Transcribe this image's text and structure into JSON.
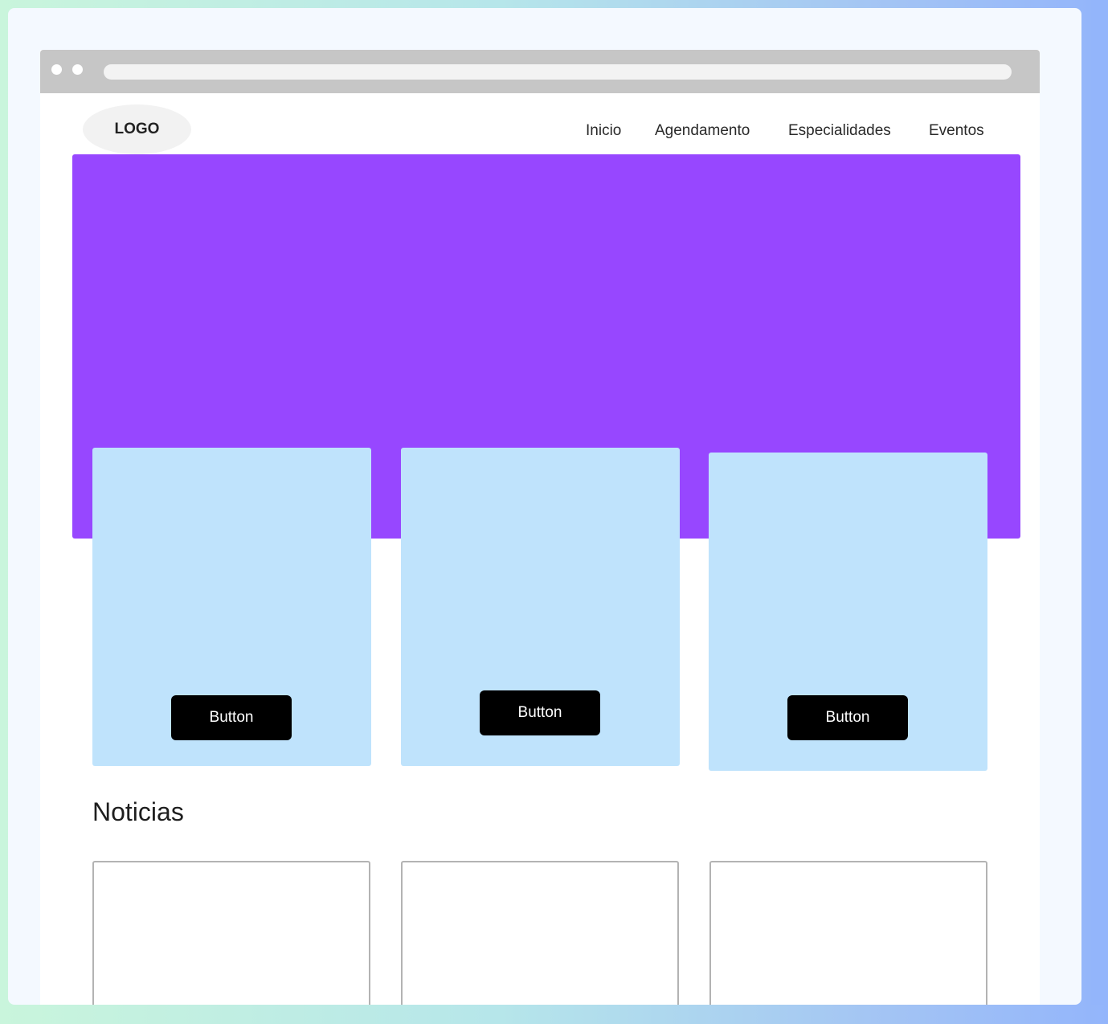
{
  "header": {
    "logo_text": "LOGO",
    "nav": [
      {
        "label": "Inicio"
      },
      {
        "label": "Agendamento"
      },
      {
        "label": "Especialidades"
      },
      {
        "label": "Eventos"
      }
    ]
  },
  "hero": {
    "color": "#9747ff"
  },
  "cards": [
    {
      "button_label": "Button"
    },
    {
      "button_label": "Button"
    },
    {
      "button_label": "Button"
    }
  ],
  "news": {
    "title": "Noticias",
    "items": [
      {},
      {},
      {}
    ]
  },
  "colors": {
    "card_bg": "#bfe3fc",
    "button_bg": "#000000",
    "browser_bar": "#c6c6c6"
  }
}
